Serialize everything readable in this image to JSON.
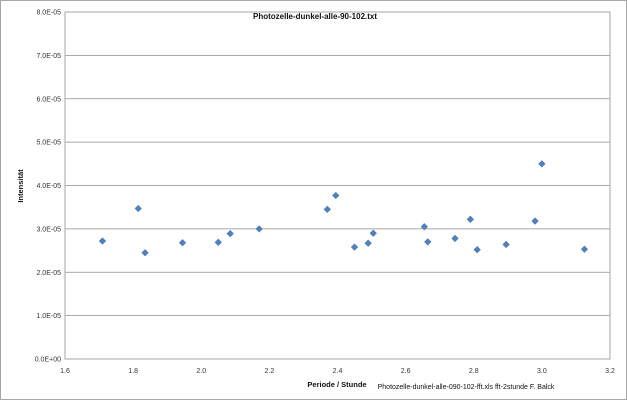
{
  "chart_data": {
    "type": "scatter",
    "title": "Photozelle-dunkel-alle-90-102.txt",
    "xlabel": "Periode / Stunde",
    "ylabel": "Intensität",
    "footnote": "Photozelle-dunkel-alle-090-102-fft.xls  fft-2stunde F. Balck",
    "xlim": [
      1.6,
      3.2
    ],
    "ylim": [
      0,
      8e-05
    ],
    "x_ticks": [
      "1.6",
      "1.8",
      "2.0",
      "2.2",
      "2.4",
      "2.6",
      "2.8",
      "3.0",
      "3.2"
    ],
    "y_ticks": [
      "0.0E+00",
      "1.0E-05",
      "2.0E-05",
      "3.0E-05",
      "4.0E-05",
      "5.0E-05",
      "6.0E-05",
      "7.0E-05",
      "8.0E-05"
    ],
    "grid": "horizontal",
    "marker": "diamond",
    "marker_color": "#4f81bd",
    "series": [
      {
        "points": [
          [
            1.71,
            2.72e-05
          ],
          [
            1.815,
            3.47e-05
          ],
          [
            1.835,
            2.45e-05
          ],
          [
            1.945,
            2.68e-05
          ],
          [
            2.05,
            2.69e-05
          ],
          [
            2.085,
            2.89e-05
          ],
          [
            2.17,
            3e-05
          ],
          [
            2.37,
            3.45e-05
          ],
          [
            2.395,
            3.77e-05
          ],
          [
            2.45,
            2.58e-05
          ],
          [
            2.49,
            2.67e-05
          ],
          [
            2.505,
            2.9e-05
          ],
          [
            2.655,
            3.05e-05
          ],
          [
            2.665,
            2.7e-05
          ],
          [
            2.745,
            2.78e-05
          ],
          [
            2.79,
            3.22e-05
          ],
          [
            2.81,
            2.52e-05
          ],
          [
            2.895,
            2.64e-05
          ],
          [
            2.98,
            3.18e-05
          ],
          [
            3.0,
            4.5e-05
          ],
          [
            3.125,
            2.53e-05
          ]
        ]
      }
    ]
  }
}
